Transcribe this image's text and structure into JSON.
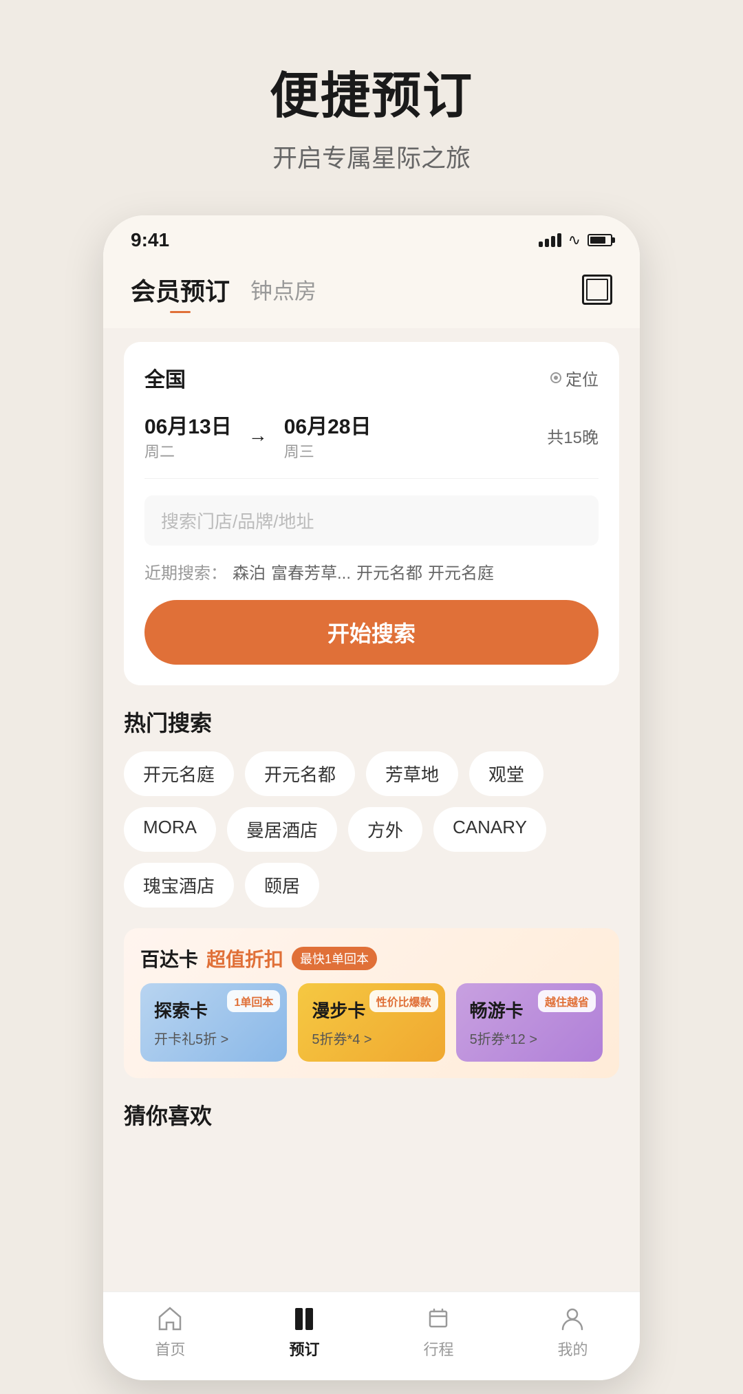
{
  "header": {
    "main_title": "便捷预订",
    "sub_title": "开启专属星际之旅"
  },
  "status_bar": {
    "time": "9:41"
  },
  "nav": {
    "tab_active": "会员预订",
    "tab_inactive": "钟点房"
  },
  "search_card": {
    "location": "全国",
    "location_btn": "定位",
    "date_start_main": "06月13日",
    "date_start_day": "周二",
    "date_arrow": "→",
    "date_end_main": "06月28日",
    "date_end_day": "周三",
    "date_nights": "共15晚",
    "search_placeholder": "搜索门店/品牌/地址",
    "recent_label": "近期搜索：",
    "recent_items": [
      "森泊",
      "富春芳草...",
      "开元名都",
      "开元名庭"
    ],
    "search_btn": "开始搜索"
  },
  "hot_search": {
    "title": "热门搜索",
    "tags": [
      "开元名庭",
      "开元名都",
      "芳草地",
      "观堂",
      "MORA",
      "曼居酒店",
      "方外",
      "CANARY",
      "瑰宝酒店",
      "颐居"
    ]
  },
  "promo": {
    "title_main": "百达卡",
    "title_sub": "超值折扣",
    "badge": "最快1单回本",
    "cards": [
      {
        "badge": "1单回本",
        "title": "探索卡",
        "desc": "开卡礼5折 >"
      },
      {
        "badge": "性价比爆款",
        "title": "漫步卡",
        "desc": "5折券*4 >"
      },
      {
        "badge": "越住越省",
        "title": "畅游卡",
        "desc": "5折券*12 >"
      }
    ]
  },
  "guess_section": {
    "title": "猜你喜欢"
  },
  "bottom_nav": {
    "items": [
      {
        "label": "首页",
        "active": false
      },
      {
        "label": "预订",
        "active": true
      },
      {
        "label": "行程",
        "active": false
      },
      {
        "label": "我的",
        "active": false
      }
    ]
  }
}
